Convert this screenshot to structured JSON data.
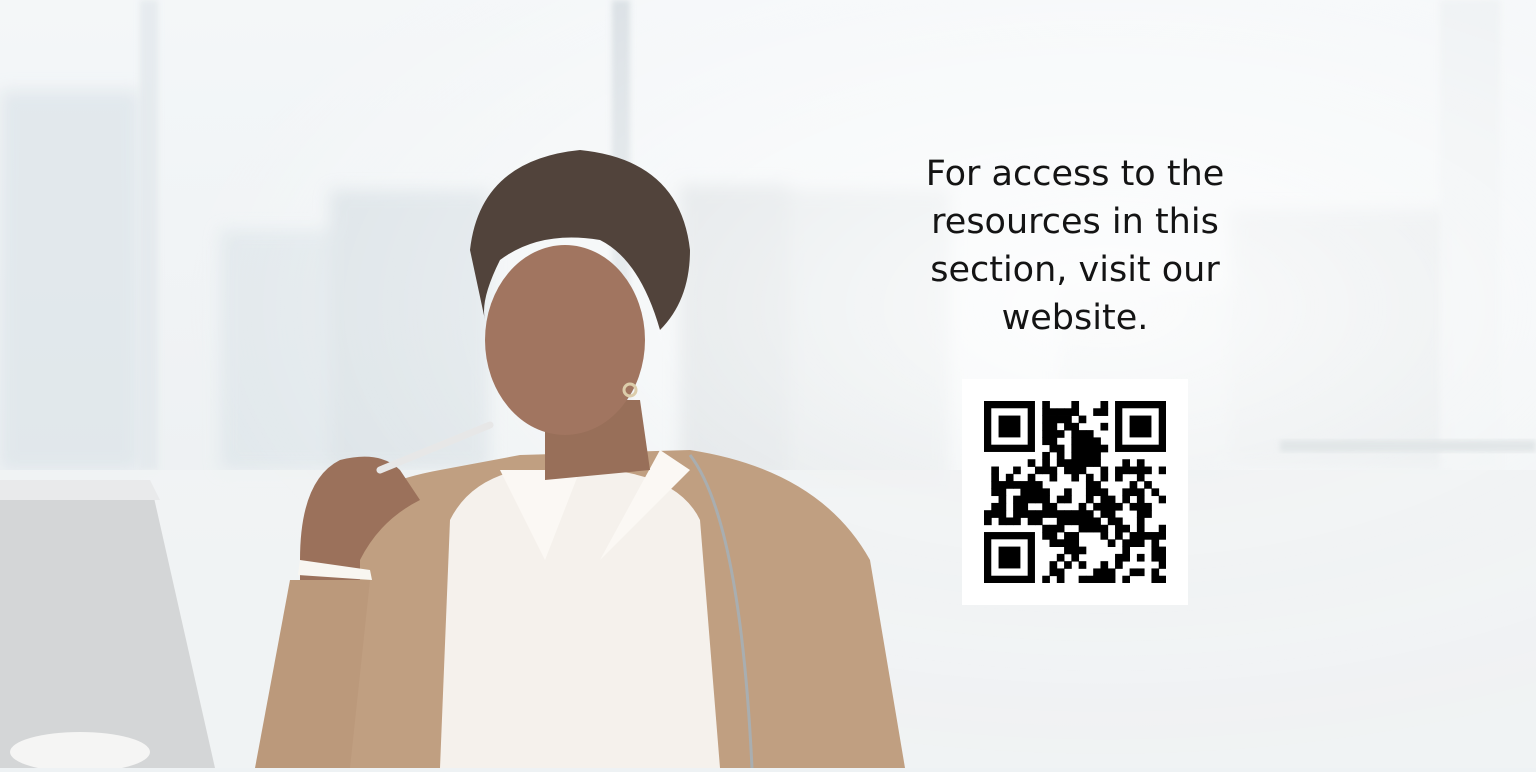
{
  "promo": {
    "lines": [
      "For access to the",
      "resources in this",
      "section, visit our",
      "website."
    ]
  },
  "qr": {
    "icon": "qr-code-icon"
  },
  "colors": {
    "text": "#141414",
    "card": "#ffffff",
    "background": "#eef2f4"
  }
}
